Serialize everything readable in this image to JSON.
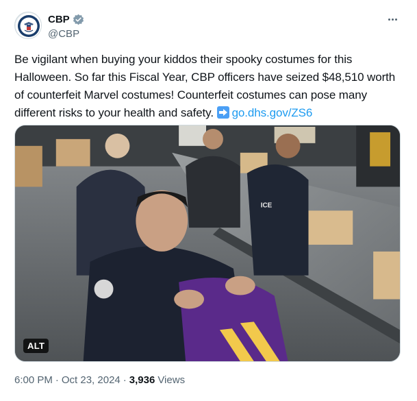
{
  "author": {
    "name": "CBP",
    "handle": "@CBP",
    "verified_color": "#829aab"
  },
  "tweet": {
    "text": "Be vigilant when buying your kiddos their spooky costumes for this Halloween. So far this Fiscal Year, CBP officers have seized $48,510 worth of counterfeit Marvel costumes! Counterfeit costumes can pose many different risks to your health and safety.",
    "link_emoji": "arrow-right-icon",
    "link_text": "go.dhs.gov/ZS6"
  },
  "media": {
    "alt_label": "ALT"
  },
  "meta": {
    "time": "6:00 PM",
    "separator1": "·",
    "date": "Oct 23, 2024",
    "separator2": "·",
    "views": "3,936",
    "views_label": "Views"
  },
  "colors": {
    "link": "#1d9bf0",
    "text": "#0f1419",
    "muted": "#536471"
  }
}
